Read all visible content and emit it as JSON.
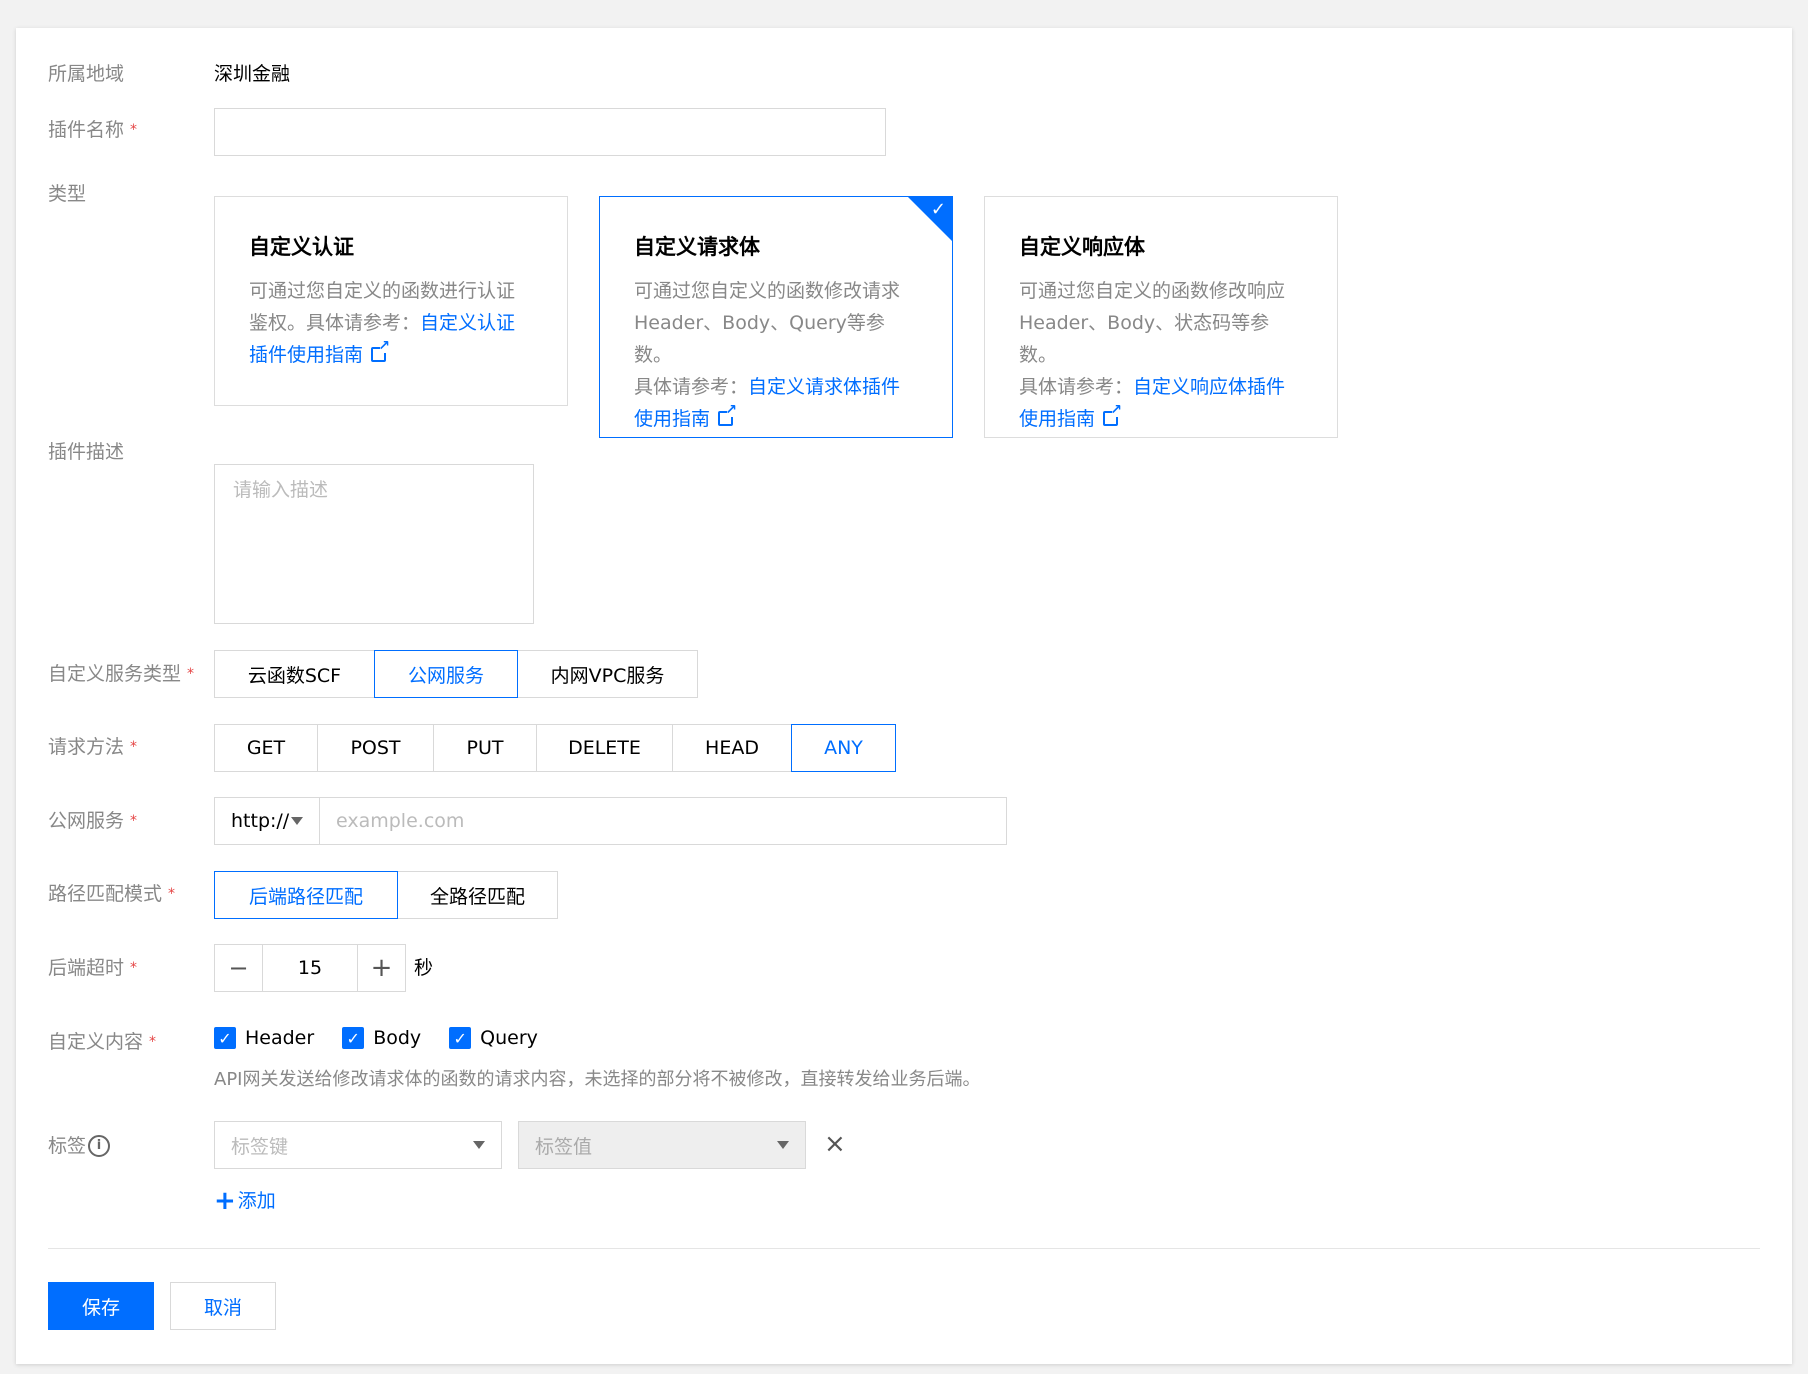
{
  "region": {
    "label": "所属地域",
    "value": "深圳金融"
  },
  "plugin_name": {
    "label": "插件名称",
    "required": "*"
  },
  "type": {
    "label": "类型",
    "cards": [
      {
        "title": "自定义认证",
        "desc": "可通过您自定义的函数进行认证鉴权。具体请参考：",
        "link": "自定义认证插件使用指南"
      },
      {
        "title": "自定义请求体",
        "desc1": "可通过您自定义的函数修改请求",
        "desc2": "Header、Body、Query等参数。",
        "desc3": "具体请参考：",
        "link1": "自定义请求体插件",
        "link2": "使用指南"
      },
      {
        "title": "自定义响应体",
        "desc1": "可通过您自定义的函数修改响应",
        "desc2": "Header、Body、状态码等参数。",
        "desc3": "具体请参考：",
        "link1": "自定义响应体插件",
        "link2": "使用指南"
      }
    ]
  },
  "description": {
    "label": "插件描述",
    "placeholder": "请输入描述"
  },
  "service_type": {
    "label": "自定义服务类型",
    "required": "*",
    "options": [
      "云函数SCF",
      "公网服务",
      "内网VPC服务"
    ],
    "selected": "公网服务"
  },
  "method": {
    "label": "请求方法",
    "required": "*",
    "options": [
      "GET",
      "POST",
      "PUT",
      "DELETE",
      "HEAD",
      "ANY"
    ],
    "selected": "ANY"
  },
  "public_service": {
    "label": "公网服务",
    "required": "*",
    "protocol": "http://",
    "placeholder": "example.com"
  },
  "path_mode": {
    "label": "路径匹配模式",
    "required": "*",
    "options": [
      "后端路径匹配",
      "全路径匹配"
    ],
    "selected": "后端路径匹配"
  },
  "timeout": {
    "label": "后端超时",
    "required": "*",
    "value": "15",
    "unit": "秒",
    "minus": "−",
    "plus": "+"
  },
  "custom_content": {
    "label": "自定义内容",
    "required": "*",
    "options": [
      "Header",
      "Body",
      "Query"
    ],
    "hint": "API网关发送给修改请求体的函数的请求内容，未选择的部分将不被修改，直接转发给业务后端。"
  },
  "tags": {
    "label": "标签",
    "key_placeholder": "标签键",
    "value_placeholder": "标签值",
    "remove": "×",
    "add_label": "添加",
    "add_icon": "+"
  },
  "actions": {
    "save": "保存",
    "cancel": "取消"
  },
  "colors": {
    "accent": "#006eff",
    "required": "#e54545"
  }
}
